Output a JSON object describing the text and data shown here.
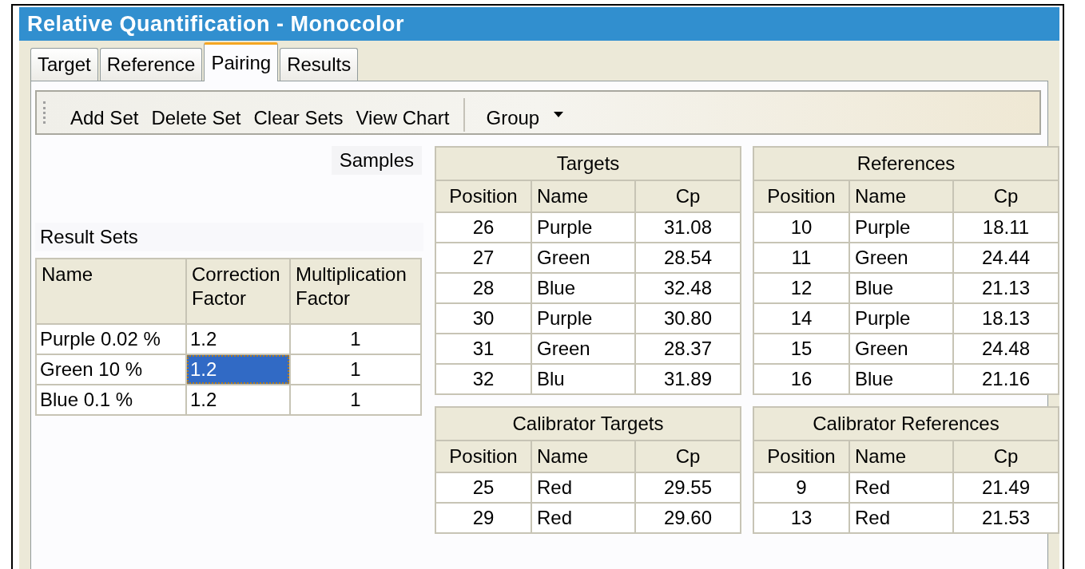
{
  "window": {
    "title": "Relative Quantification - Monocolor"
  },
  "tabs": [
    {
      "label": "Target",
      "selected": false
    },
    {
      "label": "Reference",
      "selected": false
    },
    {
      "label": "Pairing",
      "selected": true
    },
    {
      "label": "Results",
      "selected": false
    }
  ],
  "toolbar": {
    "buttons": [
      "Add Set",
      "Delete Set",
      "Clear Sets",
      "View Chart"
    ],
    "dropdown": "Group"
  },
  "samples_label": "Samples",
  "result_sets": {
    "title": "Result Sets",
    "columns": [
      "Name",
      "Correction Factor",
      "Multiplication Factor"
    ],
    "rows": [
      {
        "cells": [
          {
            "text": "Purple 0.02 %",
            "selected": false
          },
          {
            "text": "1.2",
            "selected": false
          },
          {
            "text": "1",
            "selected": false
          }
        ]
      },
      {
        "cells": [
          {
            "text": "Green 10 %",
            "selected": false
          },
          {
            "text": "1.2",
            "selected": true
          },
          {
            "text": "1",
            "selected": false
          }
        ]
      },
      {
        "cells": [
          {
            "text": "Blue 0.1 %",
            "selected": false
          },
          {
            "text": "1.2",
            "selected": false
          },
          {
            "text": "1",
            "selected": false
          }
        ]
      }
    ]
  },
  "sample_tables": [
    {
      "title": "Targets",
      "columns": [
        "Position",
        "Name",
        "Cp"
      ],
      "rows": [
        [
          "26",
          "Purple",
          "31.08"
        ],
        [
          "27",
          "Green",
          "28.54"
        ],
        [
          "28",
          "Blue",
          "32.48"
        ],
        [
          "30",
          "Purple",
          "30.80"
        ],
        [
          "31",
          "Green",
          "28.37"
        ],
        [
          "32",
          "Blu",
          "31.89"
        ]
      ]
    },
    {
      "title": "References",
      "columns": [
        "Position",
        "Name",
        "Cp"
      ],
      "rows": [
        [
          "10",
          "Purple",
          "18.11"
        ],
        [
          "11",
          "Green",
          "24.44"
        ],
        [
          "12",
          "Blue",
          "21.13"
        ],
        [
          "14",
          "Purple",
          "18.13"
        ],
        [
          "15",
          "Green",
          "24.48"
        ],
        [
          "16",
          "Blue",
          "21.16"
        ]
      ]
    },
    {
      "title": "Calibrator Targets",
      "columns": [
        "Position",
        "Name",
        "Cp"
      ],
      "rows": [
        [
          "25",
          "Red",
          "29.55"
        ],
        [
          "29",
          "Red",
          "29.60"
        ]
      ]
    },
    {
      "title": "Calibrator References",
      "columns": [
        "Position",
        "Name",
        "Cp"
      ],
      "rows": [
        [
          "9",
          "Red",
          "21.49"
        ],
        [
          "13",
          "Red",
          "21.53"
        ]
      ]
    }
  ]
}
